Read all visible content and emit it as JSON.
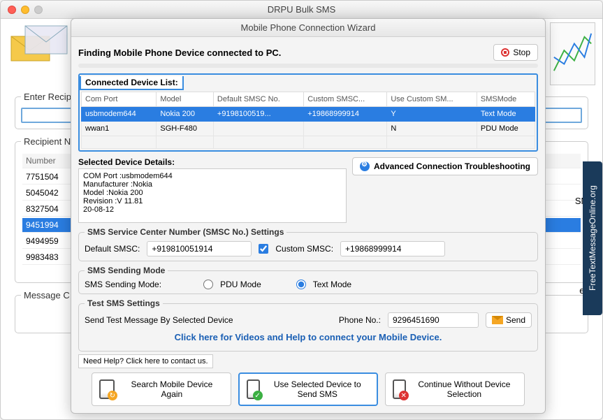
{
  "window": {
    "title": "DRPU Bulk SMS"
  },
  "bg": {
    "enter_recip": "Enter Recip",
    "recipient_n": "Recipient N",
    "number_hdr": "Number",
    "numbers": [
      "7751504",
      "5045042",
      "8327504",
      "9451994",
      "9494959",
      "9983483"
    ],
    "selected_idx": 3,
    "message_c": "Message C",
    "sms_suffix": "SMS",
    "es_suffix": "es"
  },
  "modal": {
    "title": "Mobile Phone Connection Wizard",
    "finding": "Finding Mobile Phone Device connected to PC.",
    "stop": "Stop",
    "cdl": "Connected Device List:",
    "cols": [
      "Com Port",
      "Model",
      "Default SMSC No.",
      "Custom SMSC...",
      "Use Custom SM...",
      "SMSMode"
    ],
    "rows": [
      {
        "port": "usbmodem644",
        "model": "Nokia 200",
        "def": "+9198100519...",
        "cust": "+19868999914",
        "use": "Y",
        "mode": "Text Mode"
      },
      {
        "port": "wwan1",
        "model": "SGH-F480",
        "def": "",
        "cust": "",
        "use": "N",
        "mode": "PDU Mode"
      }
    ],
    "details_title": "Selected Device Details:",
    "details_lines": [
      "COM Port :usbmodem644",
      "Manufacturer :Nokia",
      "Model :Nokia 200",
      "Revision :V 11.81",
      "20-08-12"
    ],
    "adv_btn": "Advanced Connection Troubleshooting",
    "smsc": {
      "legend": "SMS Service Center Number (SMSC No.) Settings",
      "default_lbl": "Default SMSC:",
      "default_val": "+919810051914",
      "custom_lbl": "Custom SMSC:",
      "custom_val": "+19868999914"
    },
    "mode": {
      "legend": "SMS Sending Mode",
      "lbl": "SMS Sending Mode:",
      "pdu": "PDU Mode",
      "text": "Text Mode"
    },
    "test": {
      "legend": "Test SMS Settings",
      "lbl": "Send Test Message By Selected Device",
      "phone_lbl": "Phone No.:",
      "phone_val": "9296451690",
      "send": "Send"
    },
    "help_link": "Click here for Videos and Help to connect your Mobile Device.",
    "contact": "Need Help? Click here to contact us.",
    "actions": {
      "search": "Search Mobile Device Again",
      "use": "Use Selected Device to Send SMS",
      "skip": "Continue Without Device Selection"
    }
  },
  "side_tab": "FreeTextMessageOnline.org"
}
